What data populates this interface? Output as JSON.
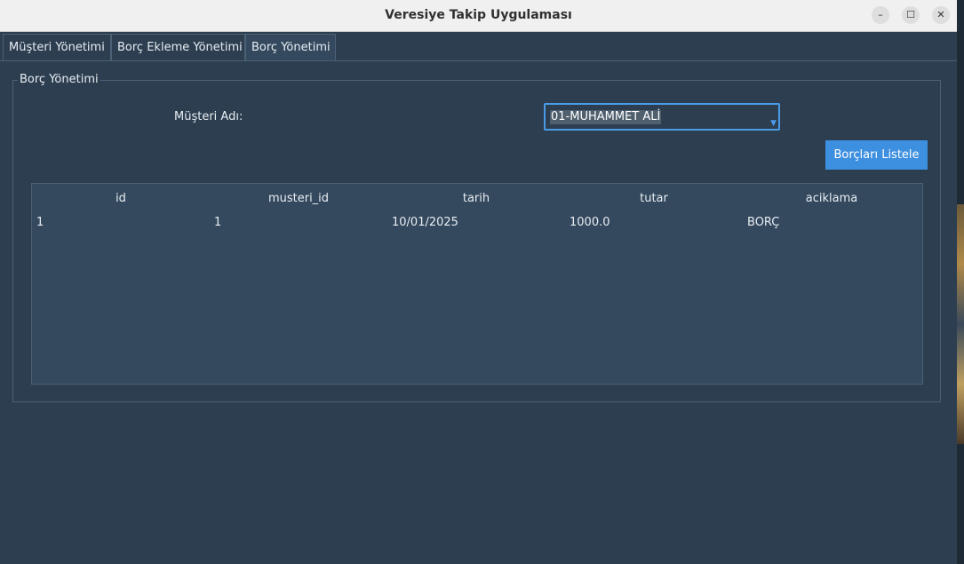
{
  "window": {
    "title": "Veresiye Takip Uygulaması"
  },
  "controls": {
    "minimize": "–",
    "maximize": "☐",
    "close": "✕"
  },
  "tabs": [
    {
      "label": "Müşteri Yönetimi",
      "active": false
    },
    {
      "label": "Borç Ekleme Yönetimi",
      "active": false
    },
    {
      "label": "Borç Yönetimi",
      "active": true
    }
  ],
  "group": {
    "title": "Borç Yönetimi",
    "customer_label": "Müşteri Adı:",
    "customer_value": "01-MUHAMMET ALİ",
    "list_button": "Borçları Listele"
  },
  "table": {
    "columns": [
      "id",
      "musteri_id",
      "tarih",
      "tutar",
      "aciklama"
    ],
    "rows": [
      [
        "1",
        "1",
        "10/01/2025",
        "1000.0",
        "BORÇ"
      ]
    ]
  },
  "colors": {
    "accent": "#3d8fe0",
    "background": "#2c3e50",
    "table_bg": "#34495e"
  }
}
